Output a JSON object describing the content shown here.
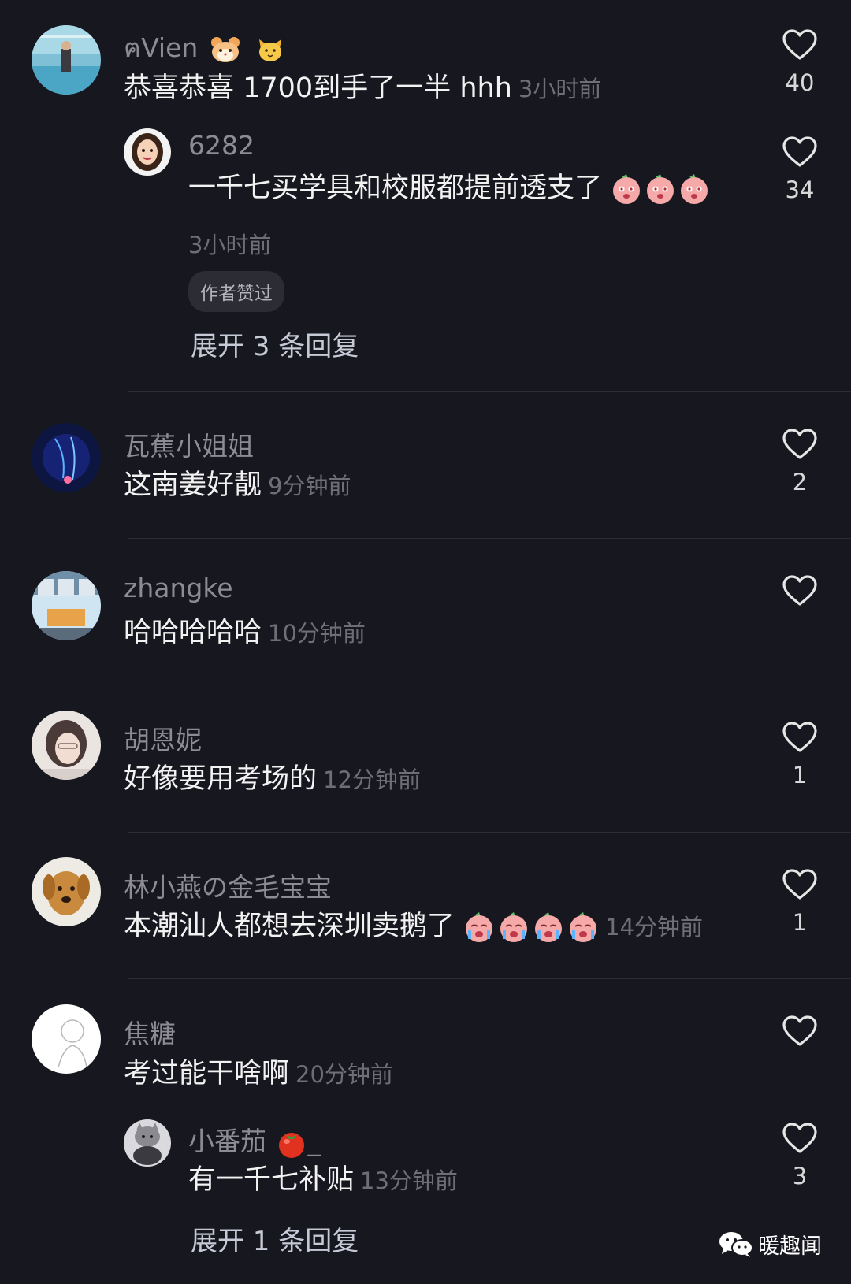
{
  "comments": [
    {
      "username": "ฅVien",
      "text": "恭喜恭喜 1700到手了一半 hhh",
      "time": "3小时前",
      "likes": "40",
      "reply": {
        "username": "6282",
        "text": "一千七买学具和校服都提前透支了",
        "time": "3小时前",
        "likes": "34",
        "badge": "作者赞过"
      },
      "expand": "展开 3 条回复"
    },
    {
      "username": "瓦蕉小姐姐",
      "text": "这南姜好靓",
      "time": "9分钟前",
      "likes": "2"
    },
    {
      "username": "zhangke",
      "text": "哈哈哈哈哈",
      "time": "10分钟前",
      "likes": ""
    },
    {
      "username": "胡恩妮",
      "text": "好像要用考场的",
      "time": "12分钟前",
      "likes": "1"
    },
    {
      "username": "林小燕の金毛宝宝",
      "text": "本潮汕人都想去深圳卖鹅了",
      "time": "14分钟前",
      "likes": "1"
    },
    {
      "username": "焦糖",
      "text": "考过能干啥啊",
      "time": "20分钟前",
      "likes": "",
      "reply": {
        "username": "小番茄",
        "username_suffix": "_",
        "text": "有一千七补贴",
        "time": "13分钟前",
        "likes": "3"
      },
      "expand": "展开 1 条回复"
    }
  ],
  "watermark": "暖趣闻",
  "colors": {
    "background": "#17171f",
    "text": "#f2f2f2",
    "username": "#8c8c92",
    "time": "#6e6e74",
    "expand": "#c6cad6"
  },
  "icons": [
    "heart-outline-icon",
    "hamster-emoji",
    "cat-emoji",
    "peach-emoji",
    "crying-peach-emoji",
    "tomato-emoji",
    "wechat-icon"
  ]
}
